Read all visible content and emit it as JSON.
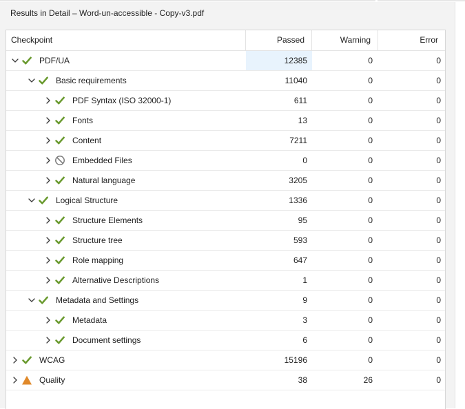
{
  "window": {
    "title": "Results in Detail – Word-un-accessible - Copy-v3.pdf"
  },
  "columns": {
    "checkpoint": "Checkpoint",
    "passed": "Passed",
    "warning": "Warning",
    "error": "Error"
  },
  "colors": {
    "check": "#6a9a2f",
    "warning_triangle": "#e0892a",
    "skipped": "#7a7a7a",
    "selected_row": "#e8f3fd"
  },
  "rows": [
    {
      "label": "PDF/UA",
      "level": 0,
      "expanded": true,
      "status": "check-icon",
      "passed": "12385",
      "warning": "0",
      "error": "0",
      "selected": true
    },
    {
      "label": "Basic requirements",
      "level": 1,
      "expanded": true,
      "status": "check-icon",
      "passed": "11040",
      "warning": "0",
      "error": "0"
    },
    {
      "label": "PDF Syntax (ISO 32000-1)",
      "level": 2,
      "expanded": false,
      "status": "check-icon",
      "passed": "611",
      "warning": "0",
      "error": "0"
    },
    {
      "label": "Fonts",
      "level": 2,
      "expanded": false,
      "status": "check-icon",
      "passed": "13",
      "warning": "0",
      "error": "0"
    },
    {
      "label": "Content",
      "level": 2,
      "expanded": false,
      "status": "check-icon",
      "passed": "7211",
      "warning": "0",
      "error": "0"
    },
    {
      "label": "Embedded Files",
      "level": 2,
      "expanded": false,
      "status": "not-applicable-icon",
      "passed": "0",
      "warning": "0",
      "error": "0"
    },
    {
      "label": "Natural language",
      "level": 2,
      "expanded": false,
      "status": "check-icon",
      "passed": "3205",
      "warning": "0",
      "error": "0"
    },
    {
      "label": "Logical Structure",
      "level": 1,
      "expanded": true,
      "status": "check-icon",
      "passed": "1336",
      "warning": "0",
      "error": "0"
    },
    {
      "label": "Structure Elements",
      "level": 2,
      "expanded": false,
      "status": "check-icon",
      "passed": "95",
      "warning": "0",
      "error": "0"
    },
    {
      "label": "Structure tree",
      "level": 2,
      "expanded": false,
      "status": "check-icon",
      "passed": "593",
      "warning": "0",
      "error": "0"
    },
    {
      "label": "Role mapping",
      "level": 2,
      "expanded": false,
      "status": "check-icon",
      "passed": "647",
      "warning": "0",
      "error": "0"
    },
    {
      "label": "Alternative Descriptions",
      "level": 2,
      "expanded": false,
      "status": "check-icon",
      "passed": "1",
      "warning": "0",
      "error": "0"
    },
    {
      "label": "Metadata and Settings",
      "level": 1,
      "expanded": true,
      "status": "check-icon",
      "passed": "9",
      "warning": "0",
      "error": "0"
    },
    {
      "label": "Metadata",
      "level": 2,
      "expanded": false,
      "status": "check-icon",
      "passed": "3",
      "warning": "0",
      "error": "0"
    },
    {
      "label": "Document settings",
      "level": 2,
      "expanded": false,
      "status": "check-icon",
      "passed": "6",
      "warning": "0",
      "error": "0"
    },
    {
      "label": "WCAG",
      "level": 0,
      "expanded": false,
      "status": "check-icon",
      "passed": "15196",
      "warning": "0",
      "error": "0"
    },
    {
      "label": "Quality",
      "level": 0,
      "expanded": false,
      "status": "warning-icon",
      "passed": "38",
      "warning": "26",
      "error": "0"
    }
  ]
}
